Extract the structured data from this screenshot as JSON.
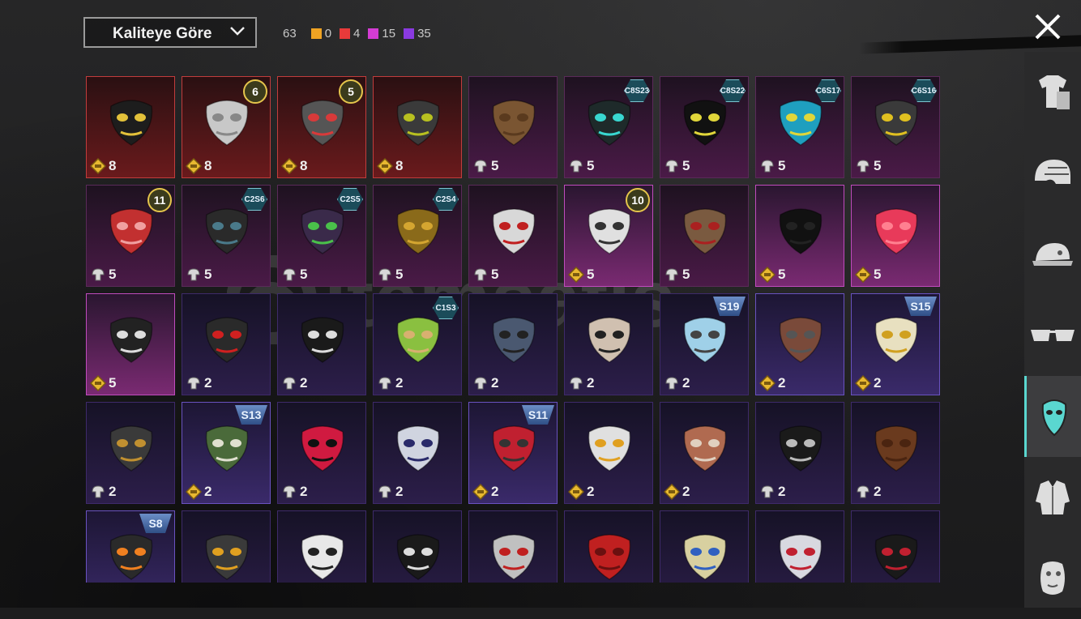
{
  "sort": {
    "label": "Kaliteye Göre"
  },
  "counts": {
    "total": "63",
    "items": [
      {
        "color": "#f0a323",
        "value": "0"
      },
      {
        "color": "#e83a3a",
        "value": "4"
      },
      {
        "color": "#d43cd4",
        "value": "15"
      },
      {
        "color": "#8a3ae0",
        "value": "35"
      }
    ]
  },
  "watermark": "itemsatis",
  "sidebar": [
    "outfit",
    "helmet",
    "hat",
    "glasses",
    "mask",
    "jacket",
    "face"
  ],
  "grid": [
    [
      {
        "q": "legendary",
        "count": "8",
        "cur": "gold",
        "mask": "#1d1d1d",
        "accent": "#e3c13a"
      },
      {
        "q": "legendary",
        "count": "8",
        "cur": "gold",
        "tag": {
          "type": "level",
          "text": "6"
        },
        "mask": "#c8c8c8",
        "accent": "#888"
      },
      {
        "q": "legendary",
        "count": "8",
        "cur": "gold",
        "tag": {
          "type": "level",
          "text": "5"
        },
        "mask": "#555",
        "accent": "#d83a3a"
      },
      {
        "q": "legendary",
        "count": "8",
        "cur": "gold",
        "mask": "#3a3a3a",
        "accent": "#b8c020"
      },
      {
        "q": "mythic",
        "count": "5",
        "cur": "silver",
        "mask": "#7a5532",
        "accent": "#5a3a1e"
      },
      {
        "q": "mythic",
        "count": "5",
        "cur": "silver",
        "tag": {
          "type": "hex",
          "text": "C8S23"
        },
        "mask": "#1e2a2a",
        "accent": "#39d7d0"
      },
      {
        "q": "mythic",
        "count": "5",
        "cur": "silver",
        "tag": {
          "type": "hex",
          "text": "C8S22"
        },
        "mask": "#111",
        "accent": "#e0d63a"
      },
      {
        "q": "mythic",
        "count": "5",
        "cur": "silver",
        "tag": {
          "type": "hex",
          "text": "C6S17"
        },
        "mask": "#1f9fbf",
        "accent": "#e0d63a"
      },
      {
        "q": "mythic",
        "count": "5",
        "cur": "silver",
        "tag": {
          "type": "hex",
          "text": "C6S16"
        },
        "mask": "#3a3a3a",
        "accent": "#e0c020"
      }
    ],
    [
      {
        "q": "mythic",
        "count": "5",
        "cur": "silver",
        "tag": {
          "type": "level",
          "text": "11"
        },
        "mask": "#c23030",
        "accent": "#f0a0a0"
      },
      {
        "q": "mythic",
        "count": "5",
        "cur": "silver",
        "tag": {
          "type": "hex",
          "text": "C2S6"
        },
        "mask": "#2a2a2a",
        "accent": "#4a7a8a"
      },
      {
        "q": "mythic",
        "count": "5",
        "cur": "silver",
        "tag": {
          "type": "hex",
          "text": "C2S5"
        },
        "mask": "#3a2a4a",
        "accent": "#4ac04a"
      },
      {
        "q": "mythic",
        "count": "5",
        "cur": "silver",
        "tag": {
          "type": "hex",
          "text": "C2S4"
        },
        "mask": "#8a6a1a",
        "accent": "#d4a530"
      },
      {
        "q": "mythic",
        "count": "5",
        "cur": "silver",
        "mask": "#d8d8d8",
        "accent": "#c02020"
      },
      {
        "q": "mythic-bright",
        "count": "5",
        "cur": "gold",
        "tag": {
          "type": "level",
          "text": "10"
        },
        "mask": "#e0e0e0",
        "accent": "#333"
      },
      {
        "q": "mythic",
        "count": "5",
        "cur": "silver",
        "mask": "#7a5a40",
        "accent": "#aa2020"
      },
      {
        "q": "mythic-bright",
        "count": "5",
        "cur": "gold",
        "mask": "#111",
        "accent": "#222"
      },
      {
        "q": "mythic-bright",
        "count": "5",
        "cur": "gold",
        "mask": "#e83a5a",
        "accent": "#ff8090"
      }
    ],
    [
      {
        "q": "mythic-bright",
        "count": "5",
        "cur": "gold",
        "mask": "#222",
        "accent": "#ddd"
      },
      {
        "q": "epic",
        "count": "2",
        "cur": "silver",
        "mask": "#2a2a2a",
        "accent": "#d02020"
      },
      {
        "q": "epic",
        "count": "2",
        "cur": "silver",
        "mask": "#1a1a1a",
        "accent": "#ddd"
      },
      {
        "q": "epic",
        "count": "2",
        "cur": "silver",
        "tag": {
          "type": "hex",
          "text": "C1S3"
        },
        "mask": "#8ac040",
        "accent": "#d8b070"
      },
      {
        "q": "epic",
        "count": "2",
        "cur": "silver",
        "mask": "#4a5870",
        "accent": "#222"
      },
      {
        "q": "epic",
        "count": "2",
        "cur": "silver",
        "mask": "#d0c0b0",
        "accent": "#222"
      },
      {
        "q": "epic",
        "count": "2",
        "cur": "silver",
        "tag": {
          "type": "shield",
          "text": "S19"
        },
        "mask": "#9fd0e8",
        "accent": "#444"
      },
      {
        "q": "epic-bright",
        "count": "2",
        "cur": "gold",
        "mask": "#7a4a3a",
        "accent": "#555"
      },
      {
        "q": "epic-bright",
        "count": "2",
        "cur": "gold",
        "tag": {
          "type": "shield",
          "text": "S15"
        },
        "mask": "#e8e0c0",
        "accent": "#d0a020"
      }
    ],
    [
      {
        "q": "epic",
        "count": "2",
        "cur": "silver",
        "mask": "#3a3a3a",
        "accent": "#c09030"
      },
      {
        "q": "epic-bright",
        "count": "2",
        "cur": "gold",
        "tag": {
          "type": "shield",
          "text": "S13"
        },
        "mask": "#4a6a3a",
        "accent": "#e0e0d0"
      },
      {
        "q": "epic",
        "count": "2",
        "cur": "silver",
        "mask": "#d01a40",
        "accent": "#111"
      },
      {
        "q": "epic",
        "count": "2",
        "cur": "silver",
        "mask": "#d0d4e0",
        "accent": "#2a2a6a"
      },
      {
        "q": "epic-bright",
        "count": "2",
        "cur": "gold",
        "tag": {
          "type": "shield",
          "text": "S11"
        },
        "mask": "#c02030",
        "accent": "#333"
      },
      {
        "q": "epic",
        "count": "2",
        "cur": "gold",
        "mask": "#e0e0e0",
        "accent": "#e0a020"
      },
      {
        "q": "epic",
        "count": "2",
        "cur": "gold",
        "mask": "#b06a50",
        "accent": "#e0d0c0"
      },
      {
        "q": "epic",
        "count": "2",
        "cur": "silver",
        "mask": "#1a1a1a",
        "accent": "#bbb"
      },
      {
        "q": "epic",
        "count": "2",
        "cur": "silver",
        "mask": "#6a3a1e",
        "accent": "#4a2410"
      }
    ],
    [
      {
        "q": "epic-bright",
        "count": "",
        "cur": "",
        "tag": {
          "type": "shield",
          "text": "S8"
        },
        "mask": "#2a2a2a",
        "accent": "#f08020"
      },
      {
        "q": "epic",
        "count": "",
        "cur": "",
        "mask": "#3a3a3a",
        "accent": "#e0a020"
      },
      {
        "q": "epic",
        "count": "",
        "cur": "",
        "mask": "#e8e8e8",
        "accent": "#222"
      },
      {
        "q": "epic",
        "count": "",
        "cur": "",
        "mask": "#1a1a1a",
        "accent": "#ddd"
      },
      {
        "q": "epic",
        "count": "",
        "cur": "",
        "mask": "#c0c0c0",
        "accent": "#c02020"
      },
      {
        "q": "epic",
        "count": "",
        "cur": "",
        "mask": "#c02020",
        "accent": "#6a1010"
      },
      {
        "q": "epic",
        "count": "",
        "cur": "",
        "mask": "#d8d0a0",
        "accent": "#3060c0"
      },
      {
        "q": "epic",
        "count": "",
        "cur": "",
        "mask": "#d8d8e0",
        "accent": "#c02030"
      },
      {
        "q": "epic",
        "count": "",
        "cur": "",
        "mask": "#1a1a1a",
        "accent": "#c02030"
      }
    ]
  ]
}
